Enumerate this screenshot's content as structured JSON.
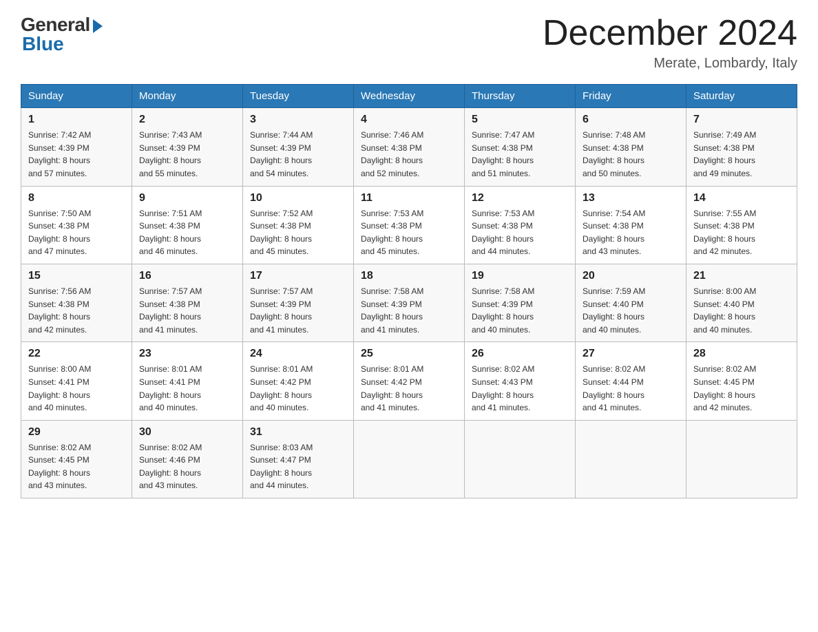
{
  "header": {
    "logo": {
      "general": "General",
      "blue": "Blue"
    },
    "title": "December 2024",
    "location": "Merate, Lombardy, Italy"
  },
  "columns": [
    "Sunday",
    "Monday",
    "Tuesday",
    "Wednesday",
    "Thursday",
    "Friday",
    "Saturday"
  ],
  "weeks": [
    [
      {
        "day": "1",
        "sunrise": "7:42 AM",
        "sunset": "4:39 PM",
        "daylight": "8 hours and 57 minutes."
      },
      {
        "day": "2",
        "sunrise": "7:43 AM",
        "sunset": "4:39 PM",
        "daylight": "8 hours and 55 minutes."
      },
      {
        "day": "3",
        "sunrise": "7:44 AM",
        "sunset": "4:39 PM",
        "daylight": "8 hours and 54 minutes."
      },
      {
        "day": "4",
        "sunrise": "7:46 AM",
        "sunset": "4:38 PM",
        "daylight": "8 hours and 52 minutes."
      },
      {
        "day": "5",
        "sunrise": "7:47 AM",
        "sunset": "4:38 PM",
        "daylight": "8 hours and 51 minutes."
      },
      {
        "day": "6",
        "sunrise": "7:48 AM",
        "sunset": "4:38 PM",
        "daylight": "8 hours and 50 minutes."
      },
      {
        "day": "7",
        "sunrise": "7:49 AM",
        "sunset": "4:38 PM",
        "daylight": "8 hours and 49 minutes."
      }
    ],
    [
      {
        "day": "8",
        "sunrise": "7:50 AM",
        "sunset": "4:38 PM",
        "daylight": "8 hours and 47 minutes."
      },
      {
        "day": "9",
        "sunrise": "7:51 AM",
        "sunset": "4:38 PM",
        "daylight": "8 hours and 46 minutes."
      },
      {
        "day": "10",
        "sunrise": "7:52 AM",
        "sunset": "4:38 PM",
        "daylight": "8 hours and 45 minutes."
      },
      {
        "day": "11",
        "sunrise": "7:53 AM",
        "sunset": "4:38 PM",
        "daylight": "8 hours and 45 minutes."
      },
      {
        "day": "12",
        "sunrise": "7:53 AM",
        "sunset": "4:38 PM",
        "daylight": "8 hours and 44 minutes."
      },
      {
        "day": "13",
        "sunrise": "7:54 AM",
        "sunset": "4:38 PM",
        "daylight": "8 hours and 43 minutes."
      },
      {
        "day": "14",
        "sunrise": "7:55 AM",
        "sunset": "4:38 PM",
        "daylight": "8 hours and 42 minutes."
      }
    ],
    [
      {
        "day": "15",
        "sunrise": "7:56 AM",
        "sunset": "4:38 PM",
        "daylight": "8 hours and 42 minutes."
      },
      {
        "day": "16",
        "sunrise": "7:57 AM",
        "sunset": "4:38 PM",
        "daylight": "8 hours and 41 minutes."
      },
      {
        "day": "17",
        "sunrise": "7:57 AM",
        "sunset": "4:39 PM",
        "daylight": "8 hours and 41 minutes."
      },
      {
        "day": "18",
        "sunrise": "7:58 AM",
        "sunset": "4:39 PM",
        "daylight": "8 hours and 41 minutes."
      },
      {
        "day": "19",
        "sunrise": "7:58 AM",
        "sunset": "4:39 PM",
        "daylight": "8 hours and 40 minutes."
      },
      {
        "day": "20",
        "sunrise": "7:59 AM",
        "sunset": "4:40 PM",
        "daylight": "8 hours and 40 minutes."
      },
      {
        "day": "21",
        "sunrise": "8:00 AM",
        "sunset": "4:40 PM",
        "daylight": "8 hours and 40 minutes."
      }
    ],
    [
      {
        "day": "22",
        "sunrise": "8:00 AM",
        "sunset": "4:41 PM",
        "daylight": "8 hours and 40 minutes."
      },
      {
        "day": "23",
        "sunrise": "8:01 AM",
        "sunset": "4:41 PM",
        "daylight": "8 hours and 40 minutes."
      },
      {
        "day": "24",
        "sunrise": "8:01 AM",
        "sunset": "4:42 PM",
        "daylight": "8 hours and 40 minutes."
      },
      {
        "day": "25",
        "sunrise": "8:01 AM",
        "sunset": "4:42 PM",
        "daylight": "8 hours and 41 minutes."
      },
      {
        "day": "26",
        "sunrise": "8:02 AM",
        "sunset": "4:43 PM",
        "daylight": "8 hours and 41 minutes."
      },
      {
        "day": "27",
        "sunrise": "8:02 AM",
        "sunset": "4:44 PM",
        "daylight": "8 hours and 41 minutes."
      },
      {
        "day": "28",
        "sunrise": "8:02 AM",
        "sunset": "4:45 PM",
        "daylight": "8 hours and 42 minutes."
      }
    ],
    [
      {
        "day": "29",
        "sunrise": "8:02 AM",
        "sunset": "4:45 PM",
        "daylight": "8 hours and 43 minutes."
      },
      {
        "day": "30",
        "sunrise": "8:02 AM",
        "sunset": "4:46 PM",
        "daylight": "8 hours and 43 minutes."
      },
      {
        "day": "31",
        "sunrise": "8:03 AM",
        "sunset": "4:47 PM",
        "daylight": "8 hours and 44 minutes."
      },
      null,
      null,
      null,
      null
    ]
  ]
}
